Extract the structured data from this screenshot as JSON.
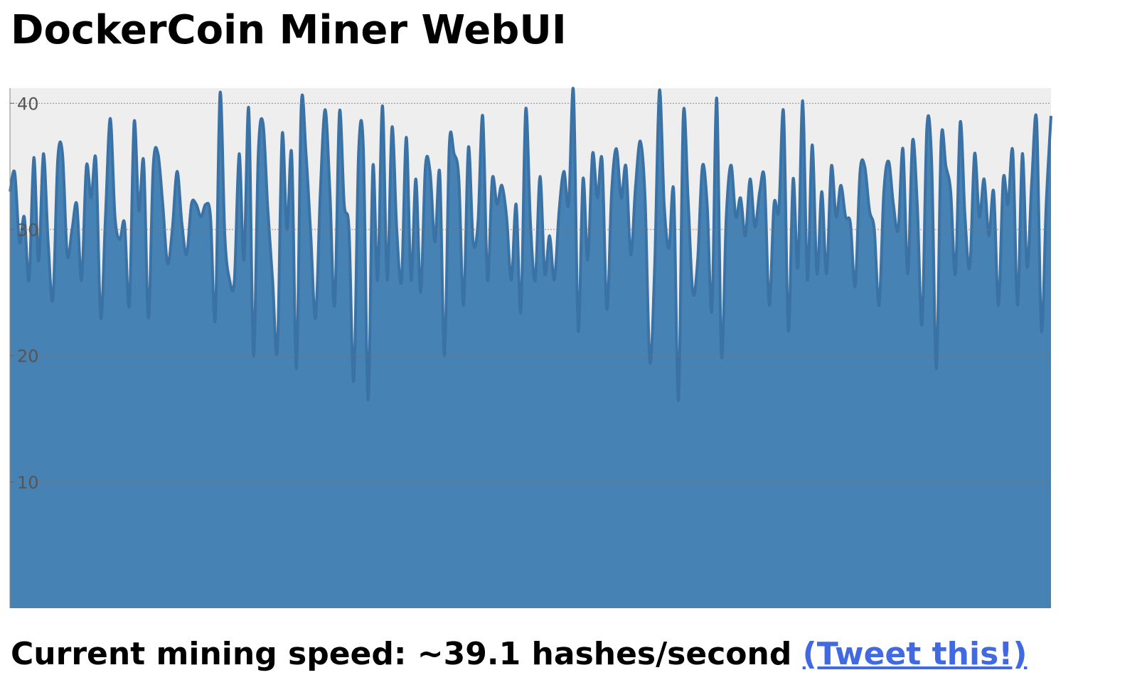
{
  "page": {
    "title": "DockerCoin Miner WebUI",
    "speed_prefix": "Current mining speed: ",
    "speed_value": "~39.1",
    "speed_unit": " hashes/second ",
    "tweet_label": "(Tweet this!)"
  },
  "colors": {
    "area_fill": "#4682b4",
    "area_stroke": "#3a72a6",
    "plot_background": "#eeeeee",
    "link": "#4169e1"
  },
  "chart_data": {
    "type": "area",
    "title": "",
    "xlabel": "",
    "ylabel": "",
    "ylim": [
      0,
      41.2
    ],
    "yticks": [
      10,
      20,
      30,
      40
    ],
    "ytick_labels": [
      "10",
      "20",
      "30",
      "40"
    ],
    "grid": true,
    "values": [
      33,
      34.5,
      29,
      31,
      26,
      35.7,
      27.5,
      36,
      29,
      24.5,
      35.5,
      36,
      28,
      30,
      32,
      26,
      35,
      32.5,
      35.5,
      23,
      31,
      38.8,
      31,
      29.2,
      30.5,
      24,
      38.5,
      31.5,
      35.4,
      23,
      35,
      36,
      32,
      27.3,
      30,
      34.6,
      30.5,
      28,
      32,
      32,
      31,
      32,
      31,
      22.9,
      40.8,
      29.5,
      26,
      26,
      36,
      27.6,
      39.6,
      20,
      36,
      38.4,
      31.6,
      26,
      20.5,
      37.5,
      30,
      36,
      19,
      39.8,
      36,
      29.5,
      23,
      33,
      39.5,
      33,
      24,
      39.3,
      32,
      30,
      18,
      36,
      36.5,
      16.5,
      35,
      26,
      39.8,
      26,
      38.1,
      30,
      26,
      37.3,
      26,
      34,
      25,
      35,
      34.5,
      29,
      34.5,
      20,
      36.6,
      36,
      34,
      24,
      36.5,
      29,
      30.5,
      39,
      26,
      34,
      32,
      33.5,
      31,
      26,
      32,
      23.5,
      39.5,
      30.5,
      26,
      34.2,
      26.5,
      29.5,
      26,
      31.5,
      34.6,
      32,
      41,
      22,
      34,
      27.6,
      36,
      32.5,
      35.5,
      23.7,
      33,
      36.4,
      32.5,
      35,
      28,
      33.4,
      37,
      32.5,
      19.5,
      27,
      41,
      32,
      28.5,
      33,
      16.5,
      39,
      32.5,
      25,
      27.5,
      35,
      32,
      23.6,
      40.4,
      20,
      31,
      35.1,
      31,
      32.5,
      29.5,
      34,
      30.2,
      33,
      34,
      24,
      32,
      31.5,
      39.3,
      22,
      34,
      27,
      40.2,
      26,
      36.7,
      26.5,
      33,
      26.5,
      35,
      31,
      33.5,
      31,
      30.5,
      25.5,
      34.5,
      35,
      31.5,
      30,
      24,
      33,
      35.4,
      32,
      30,
      36.4,
      26.5,
      37,
      32,
      22.5,
      38,
      35.5,
      19,
      37,
      35,
      33,
      26.5,
      38.5,
      31,
      27,
      36,
      31,
      34,
      29.5,
      33,
      24,
      34,
      32,
      36.2,
      24,
      36,
      27,
      34,
      38.6,
      22,
      32,
      39
    ]
  }
}
